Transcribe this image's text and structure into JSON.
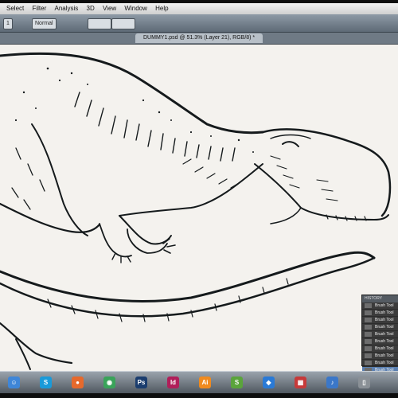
{
  "menubar": {
    "items": [
      "Select",
      "Filter",
      "Analysis",
      "3D",
      "View",
      "Window",
      "Help"
    ]
  },
  "options_bar": {
    "brush_size": "1",
    "mode": "Normal"
  },
  "document": {
    "tab_title": "DUMMY1.psd @ 51.3% (Layer 21), RGB/8) *"
  },
  "history_panel": {
    "title": "HISTORY",
    "items": [
      "Brush Tool",
      "Brush Tool",
      "Brush Tool",
      "Brush Tool",
      "Brush Tool",
      "Brush Tool",
      "Brush Tool",
      "Brush Tool",
      "Brush Tool",
      "Brush Tool"
    ]
  },
  "dock": {
    "apps": [
      {
        "icon": "finder-icon",
        "color": "#3f86d8",
        "glyph": "☺"
      },
      {
        "icon": "skype-icon",
        "color": "#1a9ad9",
        "glyph": "S"
      },
      {
        "icon": "firefox-icon",
        "color": "#e6692c",
        "glyph": "●"
      },
      {
        "icon": "chrome-icon",
        "color": "#3aa35a",
        "glyph": "◉"
      },
      {
        "icon": "photoshop-icon",
        "color": "#1b3d6e",
        "glyph": "Ps"
      },
      {
        "icon": "indesign-icon",
        "color": "#b01f5a",
        "glyph": "Id"
      },
      {
        "icon": "illustrator-icon",
        "color": "#f08a1e",
        "glyph": "Ai"
      },
      {
        "icon": "sketchbook-icon",
        "color": "#5aa43b",
        "glyph": "S"
      },
      {
        "icon": "safari-icon",
        "color": "#2a7ad6",
        "glyph": "◆"
      },
      {
        "icon": "calendar-icon",
        "color": "#c63a3a",
        "glyph": "▦"
      },
      {
        "icon": "itunes-icon",
        "color": "#3b77c8",
        "glyph": "♪"
      },
      {
        "icon": "trash-icon",
        "color": "#8a9096",
        "glyph": "▯"
      }
    ]
  }
}
